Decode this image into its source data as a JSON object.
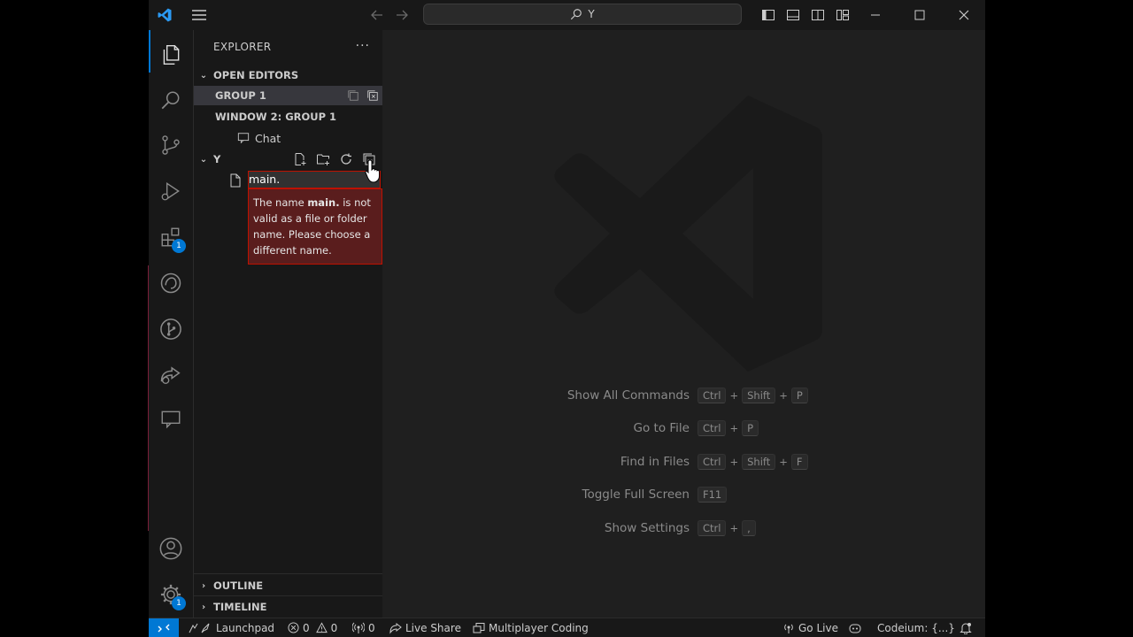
{
  "titlebar": {
    "search_text": "Y"
  },
  "sidebar": {
    "title": "EXPLORER",
    "open_editors_label": "OPEN EDITORS",
    "group1_label": "GROUP 1",
    "window2_label": "WINDOW 2: GROUP 1",
    "chat_label": "Chat",
    "folder_label": "Y",
    "rename_value": "main.",
    "error_text_before": "The name ",
    "error_name": "main.",
    "error_text_after": " is not valid as a file or folder name. Please choose a different name.",
    "outline_label": "OUTLINE",
    "timeline_label": "TIMELINE"
  },
  "activity_badges": {
    "extensions": "1",
    "settings": "1"
  },
  "editor": {
    "hints": [
      {
        "label": "Show All Commands",
        "keys": [
          "Ctrl",
          "+",
          "Shift",
          "+",
          "P"
        ]
      },
      {
        "label": "Go to File",
        "keys": [
          "Ctrl",
          "+",
          "P"
        ]
      },
      {
        "label": "Find in Files",
        "keys": [
          "Ctrl",
          "+",
          "Shift",
          "+",
          "F"
        ]
      },
      {
        "label": "Toggle Full Screen",
        "keys": [
          "F11"
        ]
      },
      {
        "label": "Show Settings",
        "keys": [
          "Ctrl",
          "+",
          ","
        ]
      }
    ]
  },
  "statusbar": {
    "launchpad": "Launchpad",
    "errors": "0",
    "warnings": "0",
    "ports": "0",
    "live_share": "Live Share",
    "multiplayer": "Multiplayer Coding",
    "go_live": "Go Live",
    "codeium": "Codeium: {...}"
  },
  "colors": {
    "accent": "#0078d4",
    "error_bg": "#5a1d1d",
    "error_border": "#be1100"
  }
}
